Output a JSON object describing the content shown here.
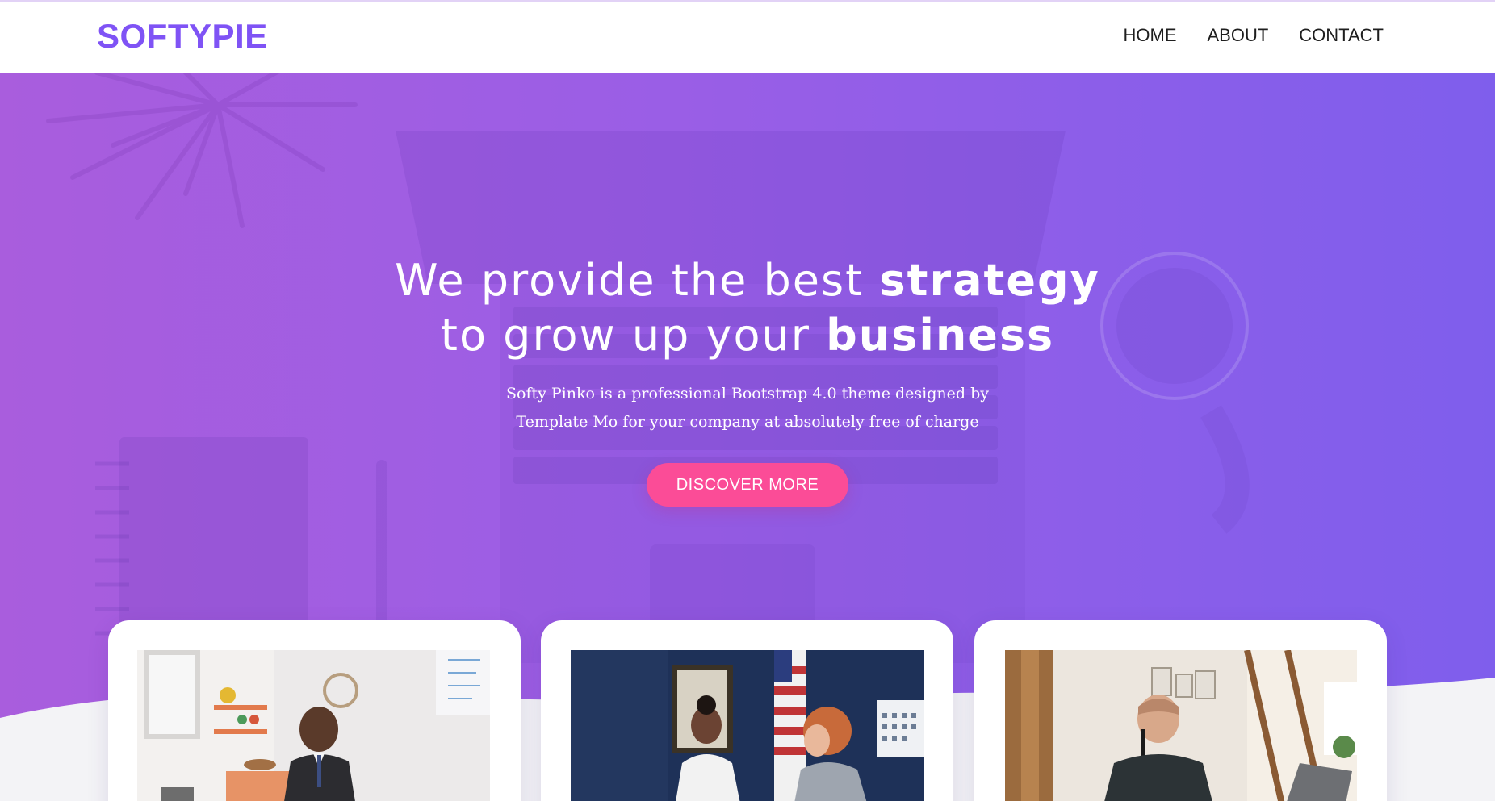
{
  "brand": {
    "logo": "SOFTYPIE",
    "accent_color": "#7f53f5"
  },
  "nav": {
    "items": [
      {
        "label": "HOME"
      },
      {
        "label": "ABOUT"
      },
      {
        "label": "CONTACT"
      }
    ]
  },
  "hero": {
    "title_line1_regular": "We provide the best ",
    "title_line1_bold": "strategy",
    "title_line2_regular": "to grow up your ",
    "title_line2_bold": "business",
    "text_line1": "Softy Pinko is a professional Bootstrap 4.0 theme designed by",
    "text_line2": "Template Mo for your company at absolutely free of charge",
    "button_label": "DISCOVER MORE",
    "gradient_start": "#a95ddd",
    "gradient_end": "#7f5eec",
    "button_color": "#fb4c97"
  },
  "cards": [
    {
      "image": "office-man-in-suit-photo"
    },
    {
      "image": "two-women-meeting-photo"
    },
    {
      "image": "woman-working-on-laptop-photo"
    }
  ]
}
